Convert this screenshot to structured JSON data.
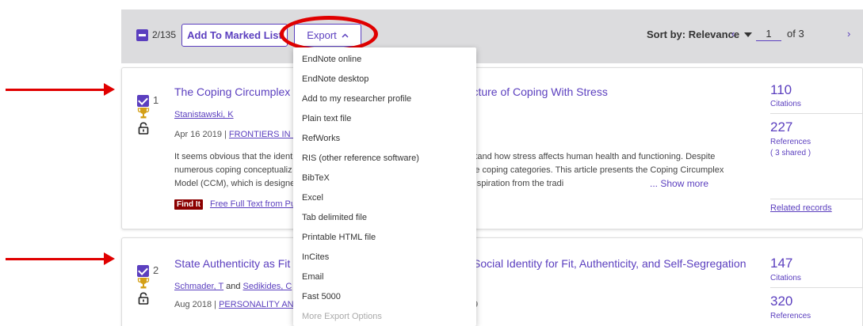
{
  "toolbar": {
    "selected_count": "2/135",
    "add_to_marked_list": "Add To Marked List",
    "export_label": "Export",
    "sort_label": "Sort by: Relevance",
    "page_current": "1",
    "page_of": "of 3",
    "prev_glyph": "‹",
    "next_glyph": "›",
    "export_caret": "^"
  },
  "export_menu": {
    "items": [
      "EndNote online",
      "EndNote desktop",
      "Add to my researcher profile",
      "Plain text file",
      "RefWorks",
      "RIS (other reference software)",
      "BibTeX",
      "Excel",
      "Tab delimited file",
      "Printable HTML file",
      "InCites",
      "Email",
      "Fast 5000"
    ],
    "more_options": "More Export Options"
  },
  "records": [
    {
      "number": "1",
      "title_part1": "The Coping Circumplex M",
      "title_part2": "ructure of Coping With Stress",
      "author": "Stanistawski, K",
      "date": "Apr 16 2019 | ",
      "journal": "FRONTIERS IN PSY",
      "abstract_line1_a": "It seems obvious that the identi",
      "abstract_line1_b": "erstand how stress affects human health and functioning. Despite",
      "abstract_line2_a": "numerous coping conceptualiz",
      "abstract_line2_b": "core coping categories. This article presents the Coping Circumplex",
      "abstract_line3_a": "Model (CCM), which is designed",
      "abstract_line3_b": "g inspiration from the tradi",
      "show_more": "...  Show more",
      "findit": "Find It",
      "fulltext": "Free Full Text from Pul",
      "citations": "110",
      "citations_label": "Citations",
      "references": "227",
      "references_label": "References",
      "shared": "( 3 shared )",
      "related": "Related records"
    },
    {
      "number": "2",
      "title_part1": "State Authenticity as Fit",
      "title_part2": "Social Identity for Fit, Authenticity, and Self-Segregation",
      "author1": "Schmader, T",
      "and": "and",
      "author2": "Sedikides, C",
      "date": "Aug 2018 | ",
      "journal": "PERSONALITY AND S",
      "meta_tail": "9",
      "citations": "147",
      "citations_label": "Citations",
      "references": "320",
      "references_label": "References"
    }
  ],
  "colors": {
    "accent": "#5b3fbf",
    "annotation_red": "#e00000",
    "toolbar_bg": "#dcdcde",
    "findit_bg": "#8b0000",
    "trophy": "#d4a017"
  }
}
